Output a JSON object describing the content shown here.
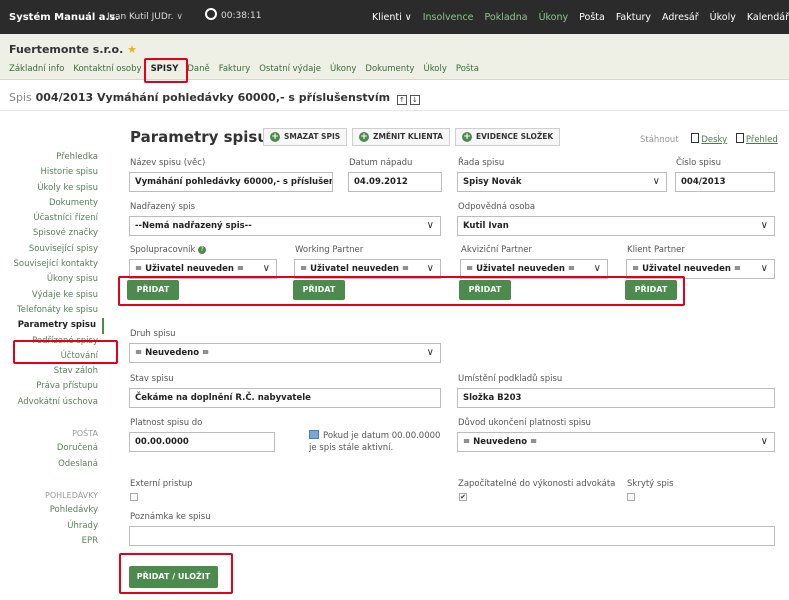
{
  "topbar": {
    "brand": "Systém Manuál a.s.",
    "user": "Ivan Kutil JUDr.",
    "user_chevron": "∨",
    "timer": "00:38:11",
    "nav": [
      "Klienti ∨",
      "Insolvence",
      "Pokladna",
      "Úkony",
      "Pošta",
      "Faktury",
      "Adresář",
      "Úkoly",
      "Kalendář"
    ]
  },
  "client": {
    "name": "Fuertemonte s.r.o.",
    "star": "★",
    "tabs": [
      "Základní info",
      "Kontaktní osoby",
      "SPISY",
      "Daně",
      "Faktury",
      "Ostatní výdaje",
      "Úkony",
      "Dokumenty",
      "Úkoly",
      "Pošta"
    ]
  },
  "spis": {
    "prefix": "Spis",
    "title": "004/2013 Vymáhání pohledávky 60000,- s příslušenstvím",
    "icon1": "↑",
    "icon2": "↓"
  },
  "sidebar": {
    "items": [
      "Přehledka",
      "Historie spisu",
      "Úkoly ke spisu",
      "Dokumenty",
      "Účastníci řízení",
      "Spisové značky",
      "Související spisy",
      "Související kontakty",
      "Úkony spisu",
      "Výdaje ke spisu",
      "Telefonáty ke spisu",
      "Parametry spisu",
      "Podřízené spisy",
      "Účtování",
      "Stav záloh",
      "Práva přístupu",
      "Advokátní úschova"
    ],
    "posta_header": "POŠTA",
    "posta": [
      "Doručená",
      "Odeslaná"
    ],
    "pohledavky_header": "POHLEDÁVKY",
    "pohledavky": [
      "Pohledávky",
      "Úhrady",
      "EPR"
    ]
  },
  "main": {
    "title": "Parametry spisu",
    "buttons": {
      "smazat": "SMAZAT SPIS",
      "zmenit": "ZMĚNIT KLIENTA",
      "evidence": "EVIDENCE SLOŽEK",
      "plus": "+"
    },
    "download": {
      "label": "Stáhnout",
      "desky": "Desky",
      "prehled": "Přehled"
    },
    "caret": "∨",
    "fields": {
      "nazev_label": "Název spisu (věc)",
      "nazev_value": "Vymáhání pohledávky 60000,- s příslušenstvím",
      "datum_label": "Datum nápadu",
      "datum_value": "04.09.2012",
      "rada_label": "Řada spisu",
      "rada_value": "Spisy Novák",
      "cislo_label": "Číslo spisu",
      "cislo_value": "004/2013",
      "nadrazeny_label": "Nadřazený spis",
      "nadrazeny_value": "--Nemá nadřazený spis--",
      "odpovedna_label": "Odpovědná osoba",
      "odpovedna_value": "Kutil Ivan",
      "spolupracovnik_label": "Spolupracovník",
      "info_icon": "?",
      "working_label": "Working Partner",
      "akvizicni_label": "Akviziční Partner",
      "klient_label": "Klient Partner",
      "partner_value": "= Uživatel neuveden =",
      "pridat": "PŘIDAT",
      "druh_label": "Druh spisu",
      "druh_value": "= Neuvedeno =",
      "stav_label": "Stav spisu",
      "stav_value": "Čekáme na doplnění R.Č. nabyvatele",
      "umisteni_label": "Umístění podkladů spisu",
      "umisteni_value": "Složka B203",
      "platnost_label": "Platnost spisu do",
      "platnost_value": "00.00.0000",
      "platnost_note": "Pokud je datum 00.00.0000 je spis stále aktivní.",
      "duvod_label": "Důvod ukončení platnosti spisu",
      "duvod_value": "= Neuvedeno =",
      "externi_label": "Externí pristup",
      "zapocitatelne_label": "Započítatelné do výkonosti advokáta",
      "zapocitatelne_check": "✔",
      "skryty_label": "Skrytý spis",
      "poznamka_label": "Poznámka ke spisu",
      "poznamka_value": ""
    },
    "save": "PŘIDAT / ULOŽIT"
  },
  "colors": {
    "accent": "#4d8a4d",
    "highlight": "#e3001b",
    "topbar": "#2b2b2b",
    "header_bg": "#eef0e6"
  }
}
